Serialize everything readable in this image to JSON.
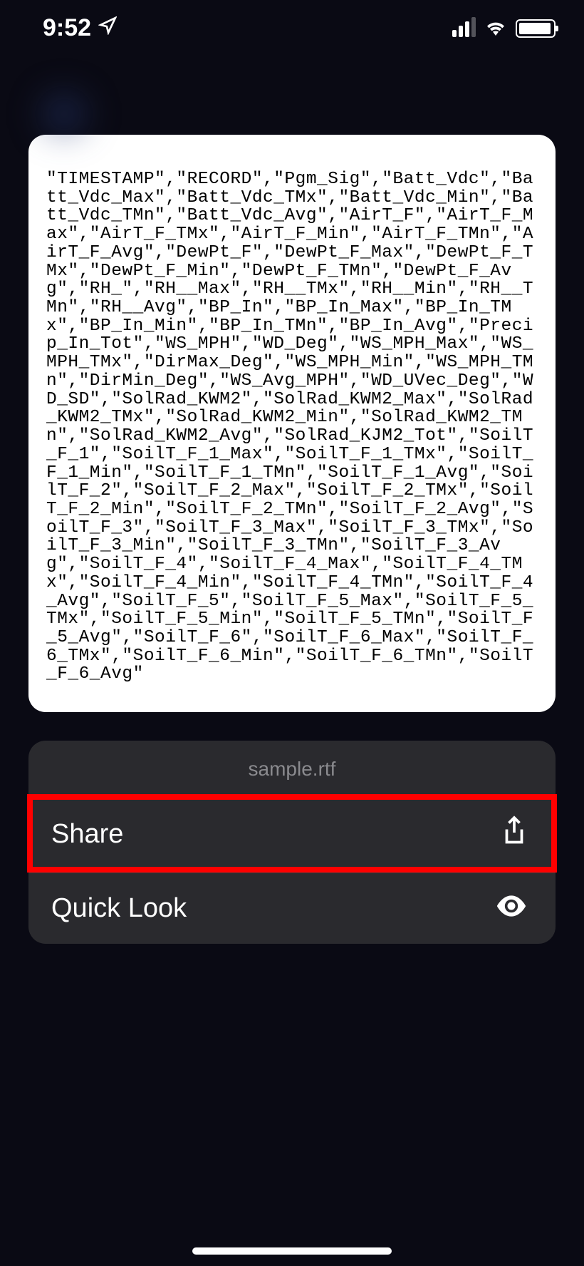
{
  "status_bar": {
    "time": "9:52"
  },
  "preview": {
    "content": "\"TIMESTAMP\",\"RECORD\",\"Pgm_Sig\",\"Batt_Vdc\",\"Batt_Vdc_Max\",\"Batt_Vdc_TMx\",\"Batt_Vdc_Min\",\"Batt_Vdc_TMn\",\"Batt_Vdc_Avg\",\"AirT_F\",\"AirT_F_Max\",\"AirT_F_TMx\",\"AirT_F_Min\",\"AirT_F_TMn\",\"AirT_F_Avg\",\"DewPt_F\",\"DewPt_F_Max\",\"DewPt_F_TMx\",\"DewPt_F_Min\",\"DewPt_F_TMn\",\"DewPt_F_Avg\",\"RH_\",\"RH__Max\",\"RH__TMx\",\"RH__Min\",\"RH__TMn\",\"RH__Avg\",\"BP_In\",\"BP_In_Max\",\"BP_In_TMx\",\"BP_In_Min\",\"BP_In_TMn\",\"BP_In_Avg\",\"Precip_In_Tot\",\"WS_MPH\",\"WD_Deg\",\"WS_MPH_Max\",\"WS_MPH_TMx\",\"DirMax_Deg\",\"WS_MPH_Min\",\"WS_MPH_TMn\",\"DirMin_Deg\",\"WS_Avg_MPH\",\"WD_UVec_Deg\",\"WD_SD\",\"SolRad_KWM2\",\"SolRad_KWM2_Max\",\"SolRad_KWM2_TMx\",\"SolRad_KWM2_Min\",\"SolRad_KWM2_TMn\",\"SolRad_KWM2_Avg\",\"SolRad_KJM2_Tot\",\"SoilT_F_1\",\"SoilT_F_1_Max\",\"SoilT_F_1_TMx\",\"SoilT_F_1_Min\",\"SoilT_F_1_TMn\",\"SoilT_F_1_Avg\",\"SoilT_F_2\",\"SoilT_F_2_Max\",\"SoilT_F_2_TMx\",\"SoilT_F_2_Min\",\"SoilT_F_2_TMn\",\"SoilT_F_2_Avg\",\"SoilT_F_3\",\"SoilT_F_3_Max\",\"SoilT_F_3_TMx\",\"SoilT_F_3_Min\",\"SoilT_F_3_TMn\",\"SoilT_F_3_Avg\",\"SoilT_F_4\",\"SoilT_F_4_Max\",\"SoilT_F_4_TMx\",\"SoilT_F_4_Min\",\"SoilT_F_4_TMn\",\"SoilT_F_4_Avg\",\"SoilT_F_5\",\"SoilT_F_5_Max\",\"SoilT_F_5_TMx\",\"SoilT_F_5_Min\",\"SoilT_F_5_TMn\",\"SoilT_F_5_Avg\",\"SoilT_F_6\",\"SoilT_F_6_Max\",\"SoilT_F_6_TMx\",\"SoilT_F_6_Min\",\"SoilT_F_6_TMn\",\"SoilT_F_6_Avg\""
  },
  "action_sheet": {
    "filename": "sample.rtf",
    "share_label": "Share",
    "quicklook_label": "Quick Look"
  }
}
